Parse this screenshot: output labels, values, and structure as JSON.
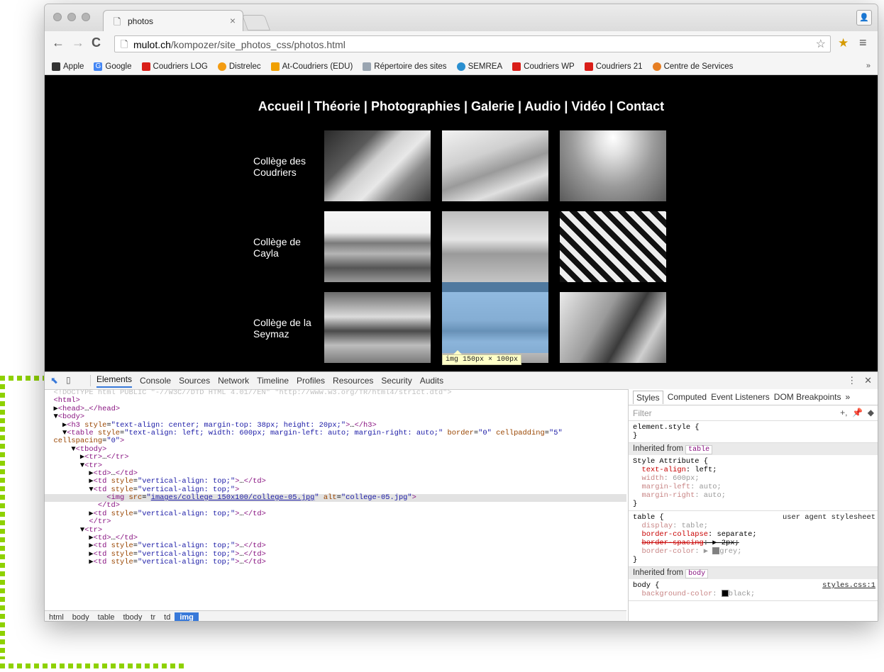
{
  "browser": {
    "tab_title": "photos",
    "tab_close": "×",
    "url_host": "mulot.ch",
    "url_path": "/kompozer/site_photos_css/photos.html"
  },
  "bookmarks": [
    {
      "label": "Apple",
      "icon": "apple-icon",
      "color": "#333333"
    },
    {
      "label": "Google",
      "icon": "google-icon",
      "color": "#4285f4"
    },
    {
      "label": "Coudriers LOG",
      "icon": "shield-icon",
      "color": "#d91e18"
    },
    {
      "label": "Distrelec",
      "icon": "circle-icon",
      "color": "#f39c12"
    },
    {
      "label": "At-Coudriers (EDU)",
      "icon": "square-icon",
      "color": "#f0a000"
    },
    {
      "label": "Répertoire des sites",
      "icon": "grid-icon",
      "color": "#9aa5b1"
    },
    {
      "label": "SEMREA",
      "icon": "drop-icon",
      "color": "#2a8fd0"
    },
    {
      "label": "Coudriers WP",
      "icon": "shield-icon",
      "color": "#d91e18"
    },
    {
      "label": "Coudriers 21",
      "icon": "shield-icon",
      "color": "#d91e18"
    },
    {
      "label": "Centre de Services",
      "icon": "lifebuoy-icon",
      "color": "#e67e22"
    }
  ],
  "bookmarks_more": "»",
  "site": {
    "nav": "Accueil | Théorie | Photographies | Galerie | Audio | Vidéo | Contact",
    "rows": [
      {
        "label": "Collège des Coudriers"
      },
      {
        "label": "Collège de Cayla"
      },
      {
        "label": "Collège de la Seymaz"
      }
    ],
    "tooltip": "img 150px × 100px"
  },
  "devtools": {
    "tabs": [
      "Elements",
      "Console",
      "Sources",
      "Network",
      "Timeline",
      "Profiles",
      "Resources",
      "Security",
      "Audits"
    ],
    "active_tab": "Elements",
    "breadcrumbs": [
      "html",
      "body",
      "table",
      "tbody",
      "tr",
      "td",
      "img"
    ],
    "styles_tabs": [
      "Styles",
      "Computed",
      "Event Listeners",
      "DOM Breakpoints",
      "»"
    ],
    "filter_placeholder": "Filter"
  }
}
